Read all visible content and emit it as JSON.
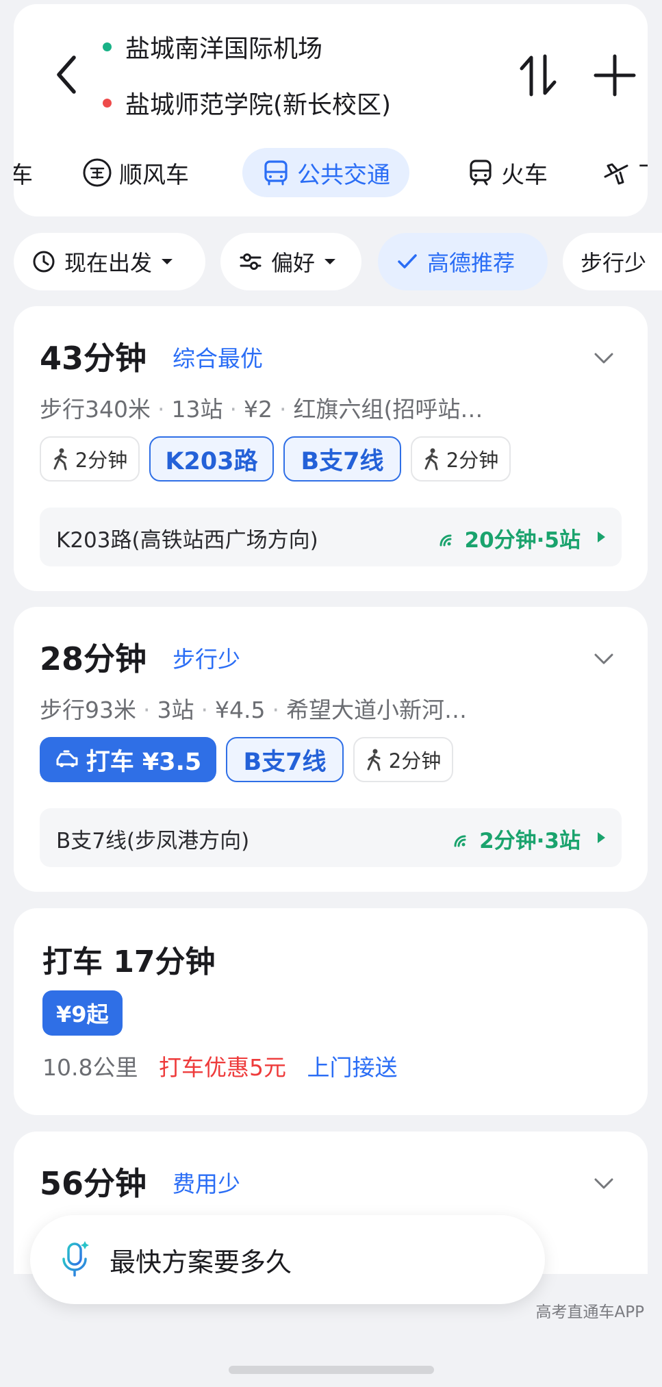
{
  "header": {
    "origin": "盐城南洋国际机场",
    "destination": "盐城师范学院(新长校区)",
    "colors": {
      "origin_dot": "#19b287",
      "destination_dot": "#ee4b4b"
    }
  },
  "modes": [
    {
      "label": "车",
      "icon": "car-icon"
    },
    {
      "label": "顺风车",
      "icon": "hitch-icon"
    },
    {
      "label": "公共交通",
      "icon": "bus-icon",
      "active": true
    },
    {
      "label": "火车",
      "icon": "train-icon"
    },
    {
      "label": "飞机",
      "icon": "plane-icon"
    }
  ],
  "filters": [
    {
      "label": "现在出发",
      "icon": "clock-icon"
    },
    {
      "label": "偏好",
      "icon": "sliders-icon"
    },
    {
      "label": "高德推荐",
      "icon": "check-icon",
      "active": true
    },
    {
      "label": "步行少"
    }
  ],
  "routes": [
    {
      "time": "43分钟",
      "tag": "综合最优",
      "summary": [
        "步行340米",
        "13站",
        "¥2",
        "红旗六组(招呼站…"
      ],
      "segments": [
        {
          "type": "walk",
          "label": "2分钟"
        },
        {
          "type": "line",
          "label": "K203路"
        },
        {
          "type": "line",
          "label": "B支7线"
        },
        {
          "type": "walk",
          "label": "2分钟"
        }
      ],
      "detail": {
        "line_direction": "K203路(高铁站西广场方向)",
        "eta": "20分钟·5站"
      }
    },
    {
      "time": "28分钟",
      "tag": "步行少",
      "summary": [
        "步行93米",
        "3站",
        "¥4.5",
        "希望大道小新河…"
      ],
      "segments": [
        {
          "type": "taxi",
          "label": "打车 ¥3.5"
        },
        {
          "type": "line",
          "label": "B支7线"
        },
        {
          "type": "walk",
          "label": "2分钟"
        }
      ],
      "detail": {
        "line_direction": "B支7线(步凤港方向)",
        "eta": "2分钟·3站"
      }
    }
  ],
  "taxi_option": {
    "title": "打车 17分钟",
    "price": "¥9起",
    "distance": "10.8公里",
    "promo": "打车优惠5元",
    "service": "上门接送"
  },
  "route_4": {
    "time": "56分钟",
    "tag": "费用少"
  },
  "voice": {
    "prompt": "最快方案要多久"
  },
  "watermark": "高考直通车APP",
  "colors": {
    "accent": "#2f6fe6",
    "eta_green": "#1aa36d",
    "promo_red": "#ee3b3b"
  }
}
